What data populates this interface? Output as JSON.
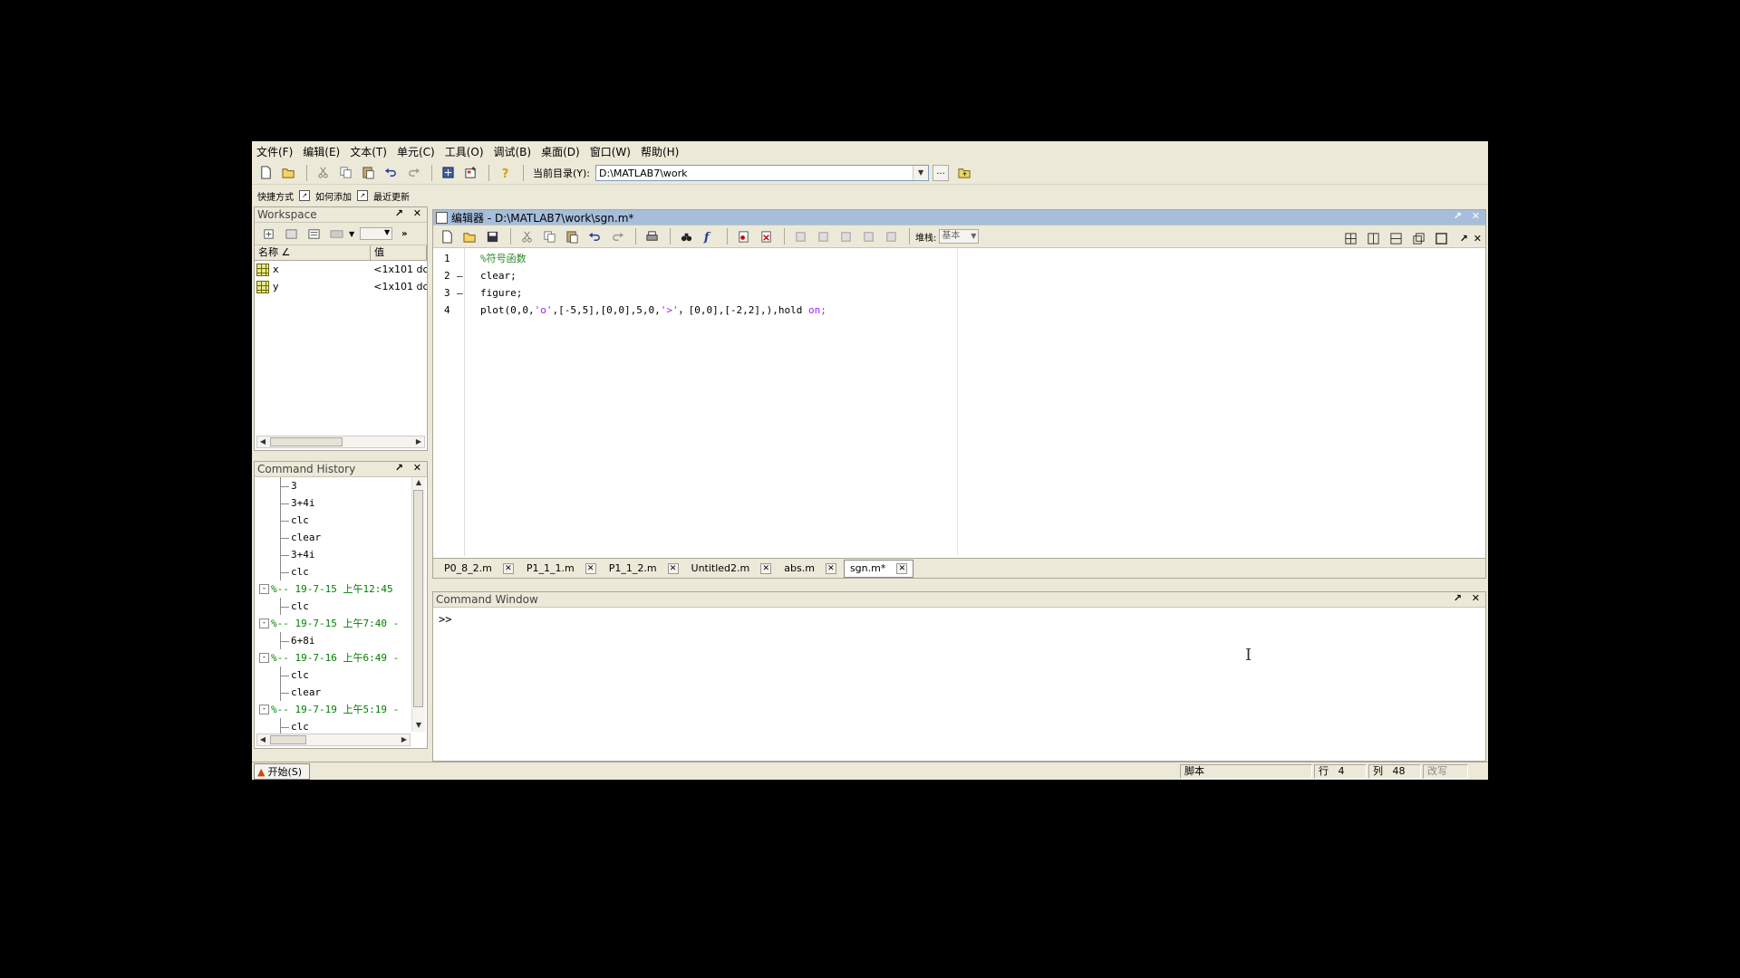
{
  "menu": [
    "文件(F)",
    "编辑(E)",
    "文本(T)",
    "单元(C)",
    "工具(O)",
    "调试(B)",
    "桌面(D)",
    "窗口(W)",
    "帮助(H)"
  ],
  "toolbar": {
    "dir_label": "当前目录(Y):",
    "dir_value": "D:\\MATLAB7\\work",
    "browse": "..."
  },
  "shortcuts": {
    "label": "快捷方式",
    "add": "如何添加",
    "recent": "最近更新"
  },
  "workspace": {
    "title": "Workspace",
    "col_name": "名称 ∠",
    "col_value": "值",
    "vars": [
      {
        "name": "x",
        "value": "<1x101 dc"
      },
      {
        "name": "y",
        "value": "<1x101 dc"
      }
    ]
  },
  "history": {
    "title": "Command History",
    "lines": [
      {
        "type": "cmd",
        "text": "3"
      },
      {
        "type": "cmd",
        "text": "3+4i"
      },
      {
        "type": "cmd",
        "text": "clc"
      },
      {
        "type": "cmd",
        "text": "clear"
      },
      {
        "type": "cmd",
        "text": "3+4i"
      },
      {
        "type": "cmd",
        "text": "clc"
      },
      {
        "type": "sess",
        "text": "%-- 19-7-15  上午12:45"
      },
      {
        "type": "cmd",
        "text": "clc"
      },
      {
        "type": "sess",
        "text": "%-- 19-7-15 上午7:40 -"
      },
      {
        "type": "cmd",
        "text": "6+8i"
      },
      {
        "type": "sess",
        "text": "%-- 19-7-16 上午6:49 -"
      },
      {
        "type": "cmd",
        "text": "clc"
      },
      {
        "type": "cmd",
        "text": "clear"
      },
      {
        "type": "sess",
        "text": "%-- 19-7-19 上午5:19 -"
      },
      {
        "type": "cmd",
        "text": "clc"
      }
    ]
  },
  "editor": {
    "title": "编辑器 - D:\\MATLAB7\\work\\sgn.m*",
    "stack_label": "堆栈:",
    "stack_value": "基本",
    "lines": [
      {
        "num": "1",
        "dash": "",
        "parts": [
          {
            "text": "%符号函数",
            "color": "green"
          }
        ]
      },
      {
        "num": "2",
        "dash": "–",
        "parts": [
          {
            "text": "clear;",
            "color": "black"
          }
        ]
      },
      {
        "num": "3",
        "dash": "–",
        "parts": [
          {
            "text": "figure;",
            "color": "black"
          }
        ]
      },
      {
        "num": "4",
        "dash": "",
        "parts": [
          {
            "text": "plot(0,0,",
            "color": "black"
          },
          {
            "text": "'o'",
            "color": "purple"
          },
          {
            "text": ",[-5,5],[0,0],5,0,",
            "color": "black"
          },
          {
            "text": "'>'",
            "color": "purple"
          },
          {
            "text": "，[0,0],[-2,2],),hold ",
            "color": "black"
          },
          {
            "text": "on;",
            "color": "purple"
          }
        ]
      }
    ],
    "tabs": [
      {
        "label": "P0_8_2.m",
        "active": false
      },
      {
        "label": "P1_1_1.m",
        "active": false
      },
      {
        "label": "P1_1_2.m",
        "active": false
      },
      {
        "label": "Untitled2.m",
        "active": false
      },
      {
        "label": "abs.m",
        "active": false
      },
      {
        "label": "sgn.m*",
        "active": true
      }
    ]
  },
  "command_window": {
    "title": "Command Window",
    "prompt": ">>"
  },
  "status": {
    "start": "开始(S)",
    "mode": "脚本",
    "row_label": "行",
    "row": "4",
    "col_label": "列",
    "col": "48",
    "ovr": "改写"
  },
  "colors": {
    "green": "#228b22",
    "purple": "#a020f0",
    "black": "#000000"
  }
}
